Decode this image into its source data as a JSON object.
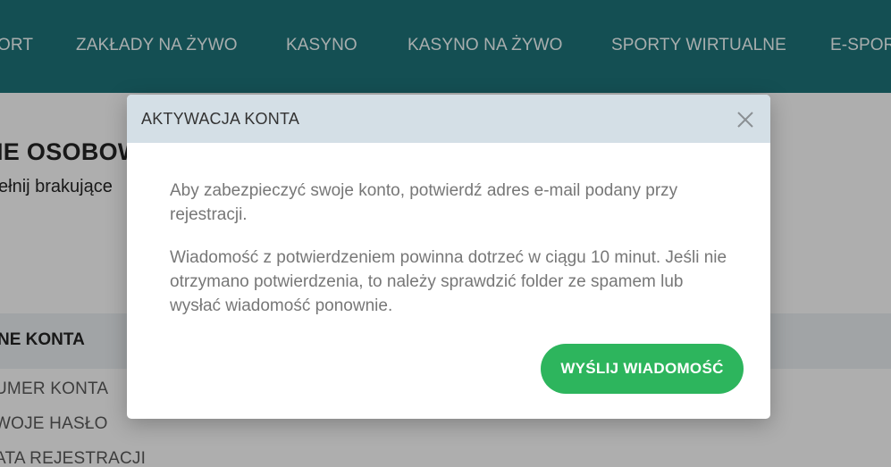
{
  "nav": {
    "items": [
      "ORT",
      "ZAKŁADY NA ŻYWO",
      "KASYNO",
      "KASYNO NA ŻYWO",
      "SPORTY WIRTUALNE",
      "E-SPORT"
    ]
  },
  "background": {
    "heading": "IE OSOBOWE",
    "subtext": "ełnij brakujące",
    "section_title": "NE KONTA",
    "rows": [
      "UMER KONTA",
      "WOJE HASŁO",
      "ATA REJESTRACJI"
    ]
  },
  "modal": {
    "title": "AKTYWACJA KONTA",
    "paragraph1": "Aby zabezpieczyć swoje konto, potwierdź adres e-mail podany przy rejestracji.",
    "paragraph2": "Wiadomość z potwierdzeniem powinna dotrzeć w ciągu 10 minut. Jeśli nie otrzymano potwierdzenia, to należy sprawdzić folder ze spamem lub wysłać wiadomość ponownie.",
    "send_button": "WYŚLIJ WIADOMOŚĆ"
  },
  "colors": {
    "nav_background": "#1d6e73",
    "button_green": "#2db55d",
    "modal_header": "#d4dfe6"
  },
  "icons": {
    "close": "close-icon"
  }
}
